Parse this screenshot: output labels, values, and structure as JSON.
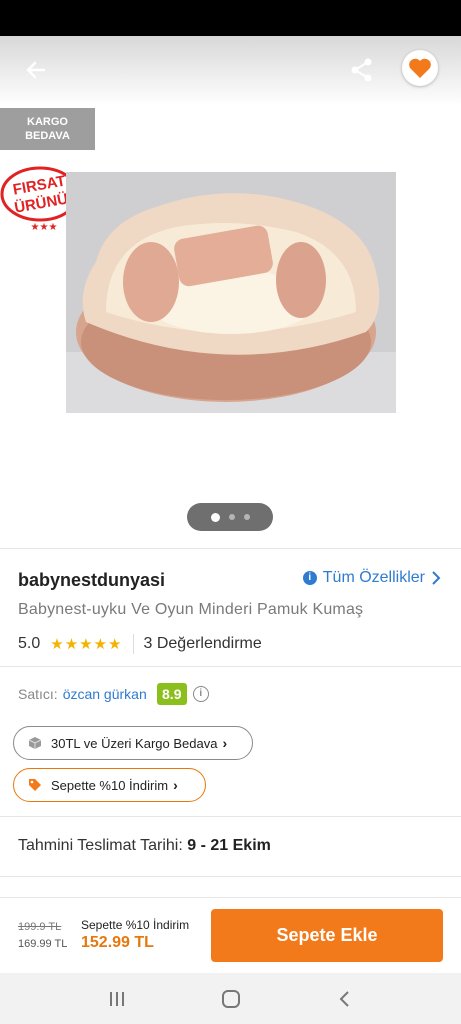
{
  "hero": {
    "cargo_badge_line1": "KARGO",
    "cargo_badge_line2": "BEDAVA",
    "firsat_line1": "FIRSAT",
    "firsat_line2": "ÜRÜNÜ",
    "image_count": 3,
    "active_image": 0
  },
  "product": {
    "brand": "babynestdunyasi",
    "all_features": "Tüm Özellikler",
    "name": "Babynest-uyku Ve Oyun Minderi Pamuk Kumaş",
    "rating": "5.0",
    "stars": "★★★★★",
    "reviews": "3 Değerlendirme"
  },
  "seller": {
    "label": "Satıcı:",
    "name": "özcan gürkan",
    "score": "8.9"
  },
  "chips": {
    "shipping": "30TL ve Üzeri Kargo Bedava",
    "discount": "Sepette %10 İndirim",
    "arrow": "›"
  },
  "delivery": {
    "label": "Tahmini Teslimat Tarihi:",
    "dates": "9 - 21 Ekim"
  },
  "bottom": {
    "old_price": "199.9 TL",
    "price_before": "169.99 TL",
    "promo": "Sepette %10 İndirim",
    "price": "152.99 TL",
    "add_to_cart": "Sepete Ekle"
  },
  "colors": {
    "accent": "#f27a1a",
    "link": "#2f7bd0",
    "score": "#8bbf1e",
    "star": "#f5b301"
  }
}
